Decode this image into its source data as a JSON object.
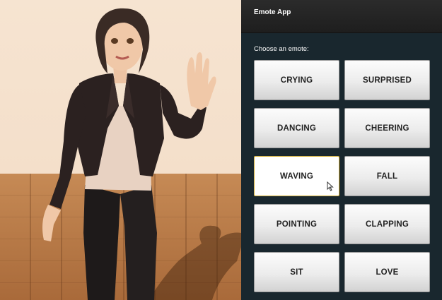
{
  "app": {
    "title": "Emote App",
    "prompt": "Choose an emote:"
  },
  "emotes": {
    "crying": "CRYING",
    "surprised": "SURPRISED",
    "dancing": "DANCING",
    "cheering": "CHEERING",
    "waving": "WAVING",
    "fall": "FALL",
    "pointing": "POINTING",
    "clapping": "CLAPPING",
    "sit": "SIT",
    "love": "LOVE"
  },
  "selected_emote": "WAVING",
  "colors": {
    "panel_bg": "#19272e",
    "titlebar_bg": "#232323",
    "button_bg": "#ececec",
    "selected_border": "#d6b23c",
    "wall": "#f4dfca",
    "floor": "#b87a48"
  },
  "icons": [
    "mouse-pointer-icon"
  ]
}
